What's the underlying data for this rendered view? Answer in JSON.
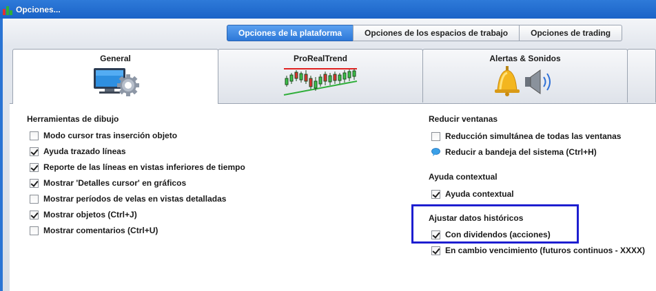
{
  "window": {
    "title": "Opciones..."
  },
  "top_buttons": [
    {
      "label": "Opciones de la plataforma",
      "active": true
    },
    {
      "label": "Opciones de los espacios de trabajo",
      "active": false
    },
    {
      "label": "Opciones de trading",
      "active": false
    }
  ],
  "tabs": [
    {
      "label": "General",
      "icon": "monitor-gear-icon",
      "active": true
    },
    {
      "label": "ProRealTrend",
      "icon": "candlestick-trend-icon",
      "active": false
    },
    {
      "label": "Alertas & Sonidos",
      "icon": "bell-speaker-icon",
      "active": false
    }
  ],
  "left": {
    "title": "Herramientas de dibujo",
    "options": [
      {
        "label": "Modo cursor tras inserción objeto",
        "checked": false
      },
      {
        "label": "Ayuda trazado líneas",
        "checked": true
      },
      {
        "label": "Reporte de las líneas en vistas inferiores de tiempo",
        "checked": true
      },
      {
        "label": "Mostrar 'Detalles cursor' en gráficos",
        "checked": true
      },
      {
        "label": "Mostrar períodos de velas en vistas detalladas",
        "checked": false
      },
      {
        "label": "Mostrar objetos (Ctrl+J)",
        "checked": true
      },
      {
        "label": "Mostrar comentarios (Ctrl+U)",
        "checked": false
      }
    ]
  },
  "right": {
    "reducir": {
      "title": "Reducir ventanas",
      "opt1": "Reducción simultánea de todas las ventanas",
      "opt2": "Reducir a bandeja del sistema (Ctrl+H)"
    },
    "ayuda": {
      "title": "Ayuda contextual",
      "opt1": "Ayuda contextual"
    },
    "ajustar": {
      "title": "Ajustar datos históricos",
      "opt1": "Con dividendos (acciones)",
      "opt2": "En cambio vencimiento (futuros continuos - XXXX)"
    }
  }
}
